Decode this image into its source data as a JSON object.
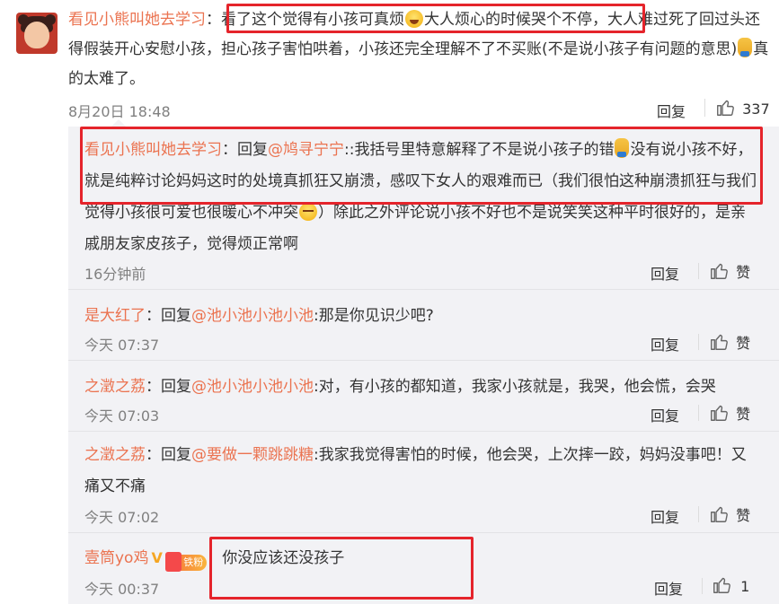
{
  "main_comment": {
    "username": "看见小熊叫她去学习",
    "text_1": "看了这个觉得有小孩可真烦",
    "text_2": "大人烦心的时候哭个不停，大人难过死了回过头还得假装开心安慰小孩，担心孩子害怕哄着，小孩还完全理解不了不买账(不是说小孩子有问题的意思)",
    "text_3": "真的太难了。",
    "timestamp": "8月20日 18:48",
    "reply_label": "回复",
    "like_count": "337"
  },
  "replies": [
    {
      "username": "看见小熊叫她去学习",
      "prefix": "：回复",
      "mention": "@鸠寻宁宁",
      "text_1": "::我括号里特意解释了不是说小孩子的错",
      "text_2": "没有说小孩不好，就是纯粹讨论妈妈这时的处境真抓狂又崩溃，感叹下女人的艰难而已（我们很怕这种崩溃抓狂与我们觉得小孩很可爱也很暖心不冲突",
      "text_3": "）除此之外评论说小孩不好也不是说笑笑这种平时很好的，是亲戚朋友家皮孩子，觉得烦正常啊",
      "timestamp": "16分钟前",
      "reply_label": "回复",
      "like_label": "赞"
    },
    {
      "username": "是大红了",
      "prefix": "：回复",
      "mention": "@池小池小池小池",
      "text_1": ":那是你见识少吧?",
      "timestamp": "今天 07:37",
      "reply_label": "回复",
      "like_label": "赞"
    },
    {
      "username": "之澂之荔",
      "prefix": "：回复",
      "mention": "@池小池小池小池",
      "text_1": ":对，有小孩的都知道，我家小孩就是，我哭，他会慌，会哭",
      "timestamp": "今天 07:03",
      "reply_label": "回复",
      "like_label": "赞"
    },
    {
      "username": "之澂之荔",
      "prefix": "：回复",
      "mention": "@要做一颗跳跳糖",
      "text_1": ":我家我觉得害怕的时候，他会哭，上次摔一跤，妈妈没事吧！又痛又不痛",
      "timestamp": "今天 07:02",
      "reply_label": "回复",
      "like_label": "赞"
    },
    {
      "username": "壹筒yo鸡",
      "badge_v": "V",
      "badge_fan": "铁粉",
      "text_1": "：你没应该还没孩子",
      "timestamp": "今天 00:37",
      "reply_label": "回复",
      "like_count": "1"
    }
  ],
  "colors": {
    "username": "#eb7350",
    "highlight_box": "#e5242b",
    "panel_bg": "#f2f2f5"
  },
  "icons": [
    "thumbs-up-icon",
    "laugh-cry-emoji",
    "worried-emoji",
    "shy-emoji",
    "verified-v-icon",
    "fan-badge-icon"
  ]
}
